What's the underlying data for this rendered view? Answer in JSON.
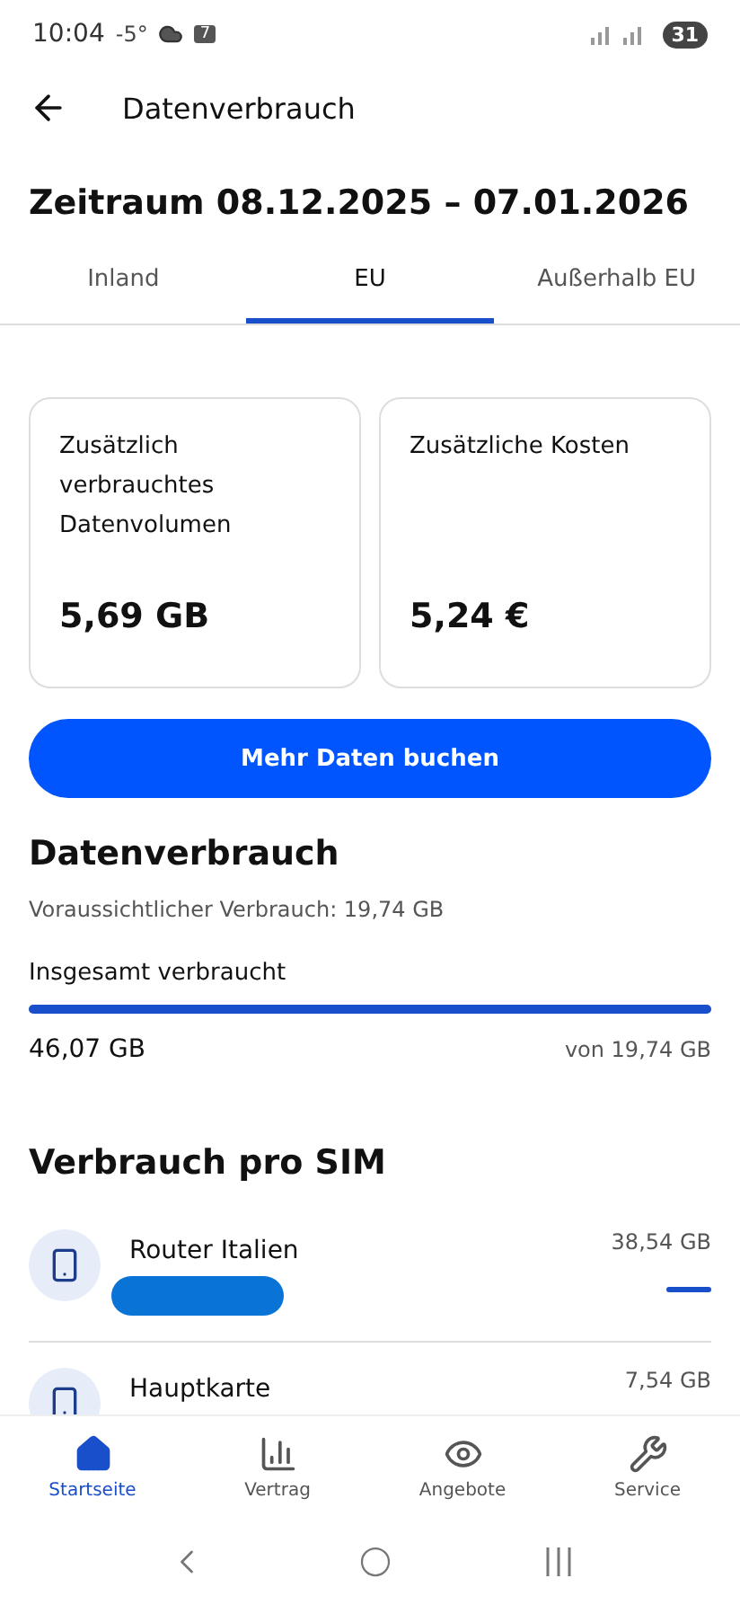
{
  "status_bar": {
    "time": "10:04",
    "temperature": "-5°",
    "calendar_day": "7",
    "battery": "31"
  },
  "header": {
    "title": "Datenverbrauch"
  },
  "period": "Zeitraum 08.12.2025 – 07.01.2026",
  "tabs": [
    {
      "label": "Inland",
      "selected": false
    },
    {
      "label": "EU",
      "selected": true
    },
    {
      "label": "Außerhalb EU",
      "selected": false
    }
  ],
  "cards": [
    {
      "label": "Zusätzlich verbrauchtes Datenvolumen",
      "value": "5,69 GB"
    },
    {
      "label": "Zusätzliche Kosten",
      "value": "5,24 €"
    }
  ],
  "book_button": "Mehr Daten buchen",
  "usage": {
    "title": "Datenverbrauch",
    "forecast": "Voraussichtlicher Verbrauch: 19,74 GB",
    "total_label": "Insgesamt verbraucht",
    "level": 1,
    "used": "46,07 GB",
    "of": "von 19,74 GB"
  },
  "sims": {
    "title": "Verbrauch pro SIM",
    "items": [
      {
        "name": "Router Italien",
        "amount": "38,54 GB"
      },
      {
        "name": "Hauptkarte",
        "amount": "7,54 GB"
      }
    ]
  },
  "nav": [
    {
      "label": "Startseite",
      "selected": true
    },
    {
      "label": "Vertrag",
      "selected": false
    },
    {
      "label": "Angebote",
      "selected": false
    },
    {
      "label": "Service",
      "selected": false
    }
  ]
}
